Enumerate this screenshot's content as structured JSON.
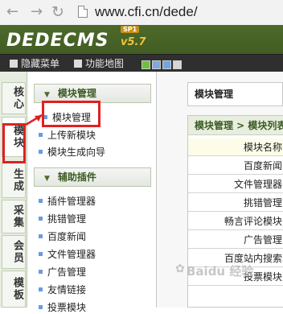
{
  "browser": {
    "back_icon": "←",
    "forward_icon": "→",
    "reload_icon": "↻",
    "url": "www.cfi.cn/dede/"
  },
  "header": {
    "logo": "DEDECMS",
    "badge": "SP1",
    "version": "v5.7",
    "toolbar": {
      "hide_menu": "隐藏菜单",
      "function_map": "功能地图"
    },
    "swatch_colors": [
      "#6fbf3f",
      "#7fa9d9",
      "#6fa6e6",
      "#d6d6d6"
    ]
  },
  "left_tabs": [
    {
      "label": "核心"
    },
    {
      "label": "模块"
    },
    {
      "label": "生成"
    },
    {
      "label": "采集"
    },
    {
      "label": "会员"
    },
    {
      "label": "模板"
    }
  ],
  "menu": {
    "group1": {
      "title": "模块管理",
      "items": [
        "模块管理",
        "上传新模块",
        "模块生成向导"
      ]
    },
    "group2": {
      "title": "辅助插件",
      "items": [
        "插件管理器",
        "挑错管理",
        "百度新闻",
        "文件管理器",
        "广告管理",
        "友情链接",
        "投票模块"
      ]
    }
  },
  "main": {
    "title": "模块管理",
    "breadcrumb": "模块管理 > 模块列表",
    "rows": [
      "模块名称",
      "百度新闻",
      "文件管理器",
      "挑错管理",
      "畅言评论模块",
      "广告管理",
      "百度站内搜索",
      "投票模块"
    ]
  },
  "watermark": "Baidu 经验",
  "colors": {
    "header_green": "#4d6a2a",
    "highlight_red": "#e02020",
    "bullet_blue": "#6a9be0"
  }
}
